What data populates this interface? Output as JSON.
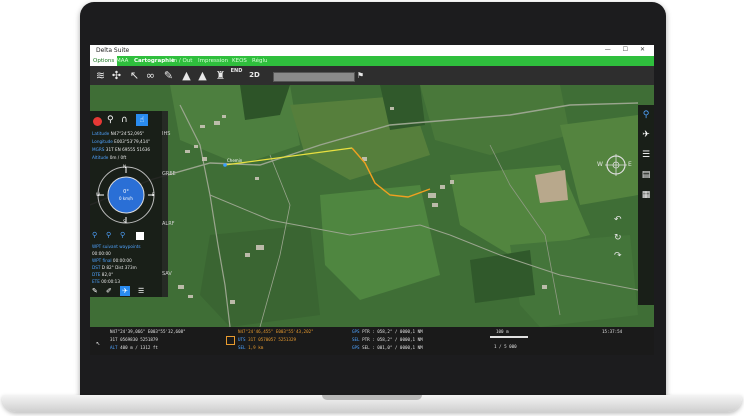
{
  "window": {
    "title": "Delta Suite",
    "controls": "— ☐ ✕"
  },
  "menu": {
    "items": [
      "Options",
      "MAA",
      "Cartographie",
      "In / Out",
      "Impression",
      "KEOS",
      "Réglu"
    ],
    "active_index": 0,
    "bold_index": 2
  },
  "toolbar": {
    "mode_label": "2D",
    "end_label": "END",
    "search_value": ""
  },
  "map": {
    "waypoint_label": "Chemin",
    "colors": {
      "route": "#f0a020",
      "leg": "#e8e040"
    }
  },
  "left_panel": {
    "latitude": {
      "label": "Latitude",
      "value": "N47°24'52,095\""
    },
    "longitude": {
      "label": "Longitude",
      "value": "E003°53'79,414\""
    },
    "mgrs": {
      "label": "MGRS",
      "value": "31T EN 69555 51636"
    },
    "altitude": {
      "label": "Altitude",
      "value": "0m / 0ft"
    },
    "heading": {
      "value": "0°"
    },
    "speed": {
      "value": "0 km/h"
    },
    "wpt_label": "WPT suivant  waypoints",
    "wpt_time": "00:00:00",
    "wpt_final": {
      "label": "WPT final",
      "value": "00:00:00"
    },
    "dst": {
      "label": "DST",
      "value": "D 82°   Dist 373m"
    },
    "dte": {
      "label": "DTE",
      "value": "82,0°"
    },
    "ete": {
      "label": "ETE",
      "value": "00:00:13"
    }
  },
  "left_strip": {
    "labels": [
      "IHS",
      "GREE",
      "ALRF",
      "SAV"
    ]
  },
  "compass": {
    "n": "N",
    "e": "E",
    "s": "S",
    "w": "W"
  },
  "status_bar": {
    "col1": [
      {
        "label": "",
        "value": "N47°24'39,066\" E003°55'32,608\""
      },
      {
        "label": "",
        "value": "31T 0569830 5251879"
      },
      {
        "label": "ALT",
        "value": "400 m / 1312 ft"
      }
    ],
    "col2": [
      {
        "label": "",
        "value": "N47°24'46,455\"  E003°55'43,202\""
      },
      {
        "label": "UTS",
        "value": "31T 0570057 5251329"
      },
      {
        "label": "SEL",
        "value": "1,9 km"
      }
    ],
    "col3": [
      {
        "label": "GPS",
        "value": "PTR : 058,2° / 0000,1 NM"
      },
      {
        "label": "SEL",
        "value": "PTR : 058,2° / 0000,1 NM"
      },
      {
        "label": "GPS",
        "value": "SEL : 001,0° / 0000,1 NM"
      }
    ],
    "scale": "100 m",
    "ratio": "1 / 5 000",
    "time": "15:37:54"
  }
}
